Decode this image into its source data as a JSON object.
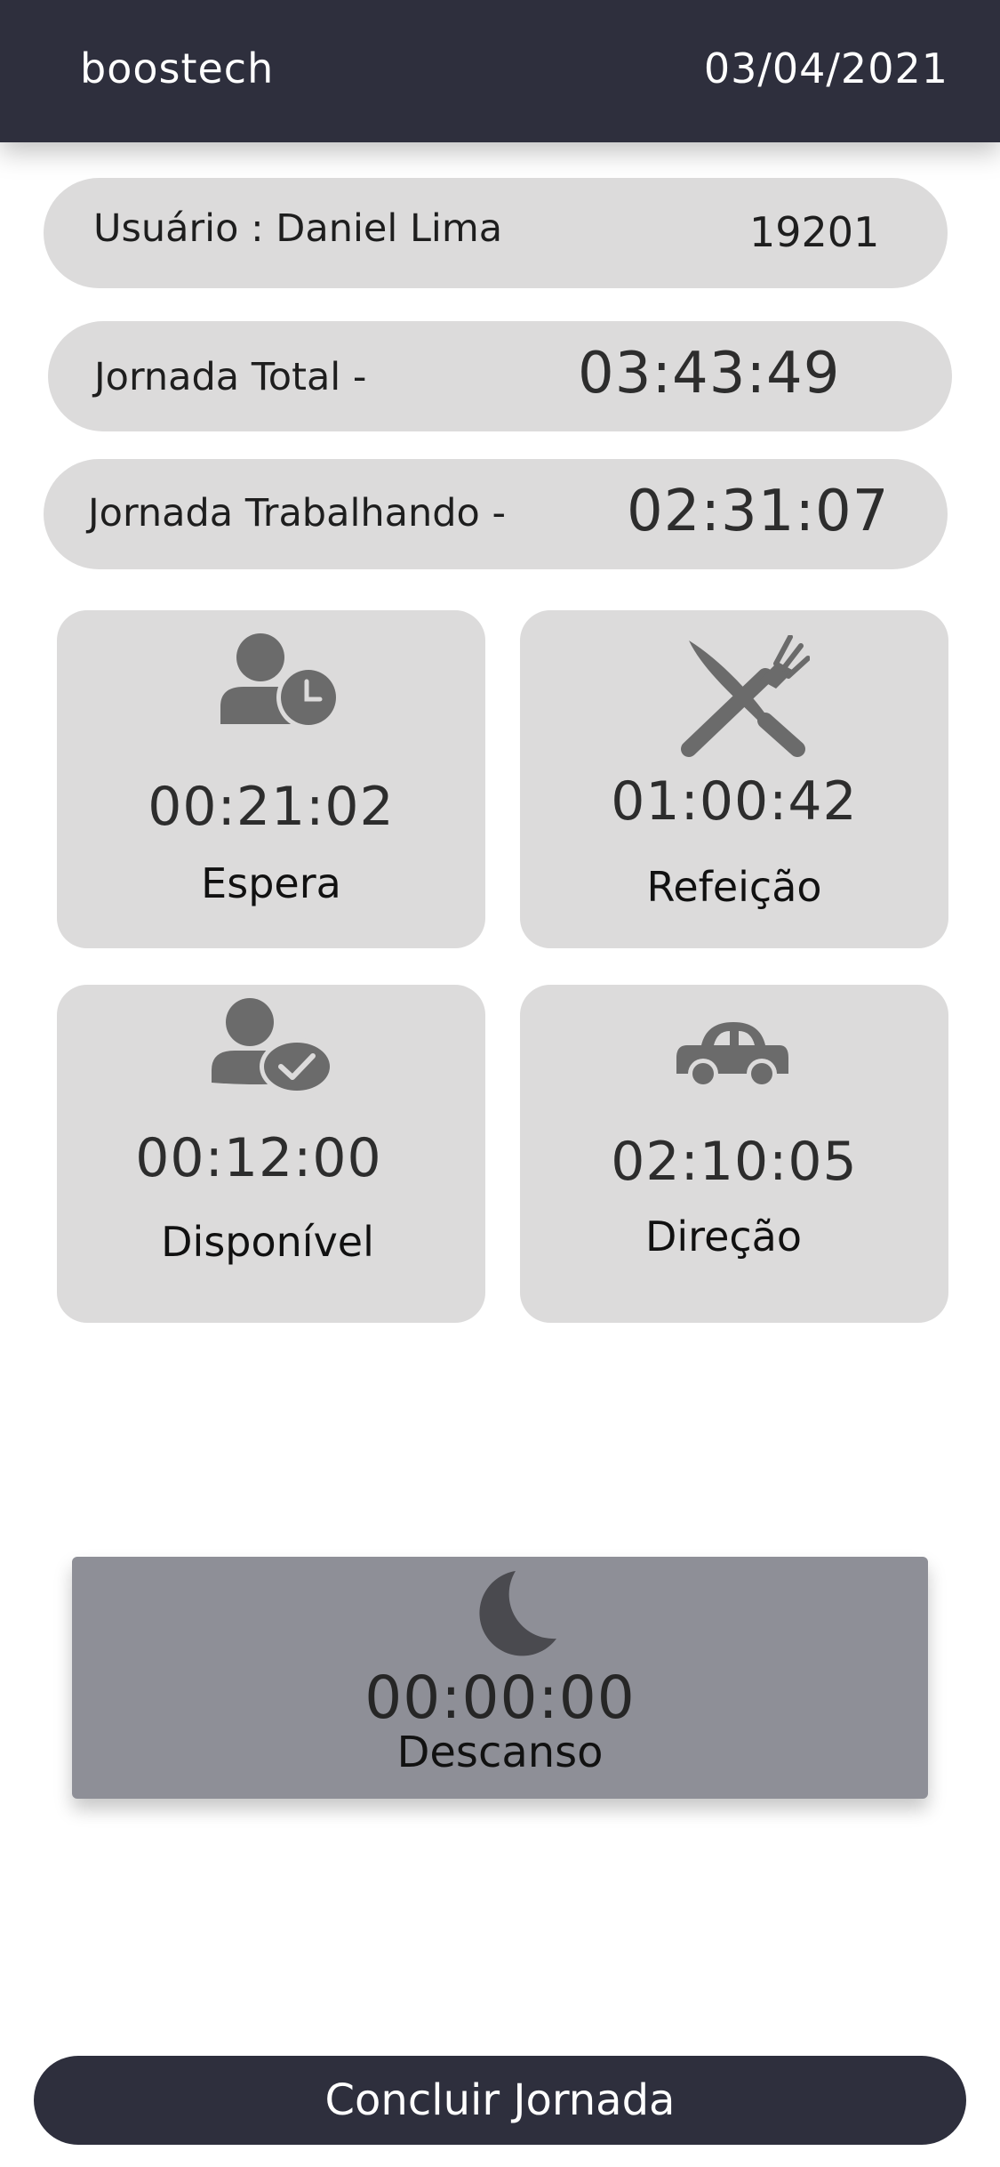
{
  "header": {
    "brand": "boostech",
    "date": "03/04/2021"
  },
  "user": {
    "label": "Usuário : Daniel Lima",
    "id": "19201"
  },
  "total": {
    "label": "Jornada Total -",
    "value": "03:43:49"
  },
  "working": {
    "label": "Jornada Trabalhando -",
    "value": "02:31:07"
  },
  "cards": [
    {
      "icon": "person-clock-icon",
      "time": "00:21:02",
      "label": "Espera"
    },
    {
      "icon": "knife-fork-icon",
      "time": "01:00:42",
      "label": "Refeição"
    },
    {
      "icon": "person-check-icon",
      "time": "00:12:00",
      "label": "Disponível"
    },
    {
      "icon": "car-icon",
      "time": "02:10:05",
      "label": "Direção"
    }
  ],
  "rest": {
    "icon": "moon-icon",
    "time": "00:00:00",
    "label": "Descanso"
  },
  "finish_button": "Concluir Jornada",
  "colors": {
    "header_bg": "#2e2f3d",
    "card_bg": "#dcdbdb",
    "rest_bg": "#8e8f97",
    "icon": "#6b6b6b"
  }
}
